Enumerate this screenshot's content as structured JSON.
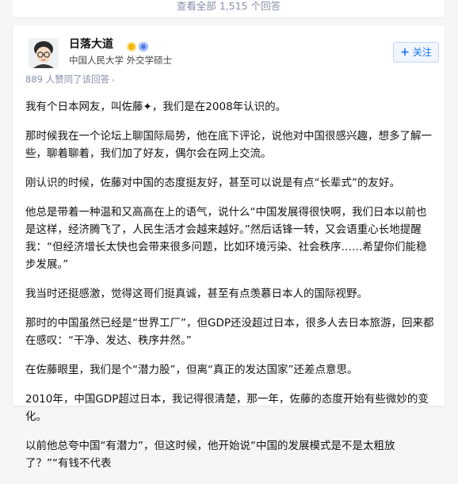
{
  "more_answers": {
    "label": "查看全部 1,515 个回答"
  },
  "author": {
    "name": "日落大道",
    "bio": "中国人民大学 外交学硕士",
    "badges": [
      "gold-badge-icon",
      "blue-badge-icon"
    ]
  },
  "follow": {
    "label": "关注"
  },
  "upvotes": {
    "label": "889 人赞同了该回答"
  },
  "paragraphs": [
    "我有个日本网友，叫佐藤✦，我们是在2008年认识的。",
    "那时候我在一个论坛上聊国际局势，他在底下评论，说他对中国很感兴趣，想多了解一些，聊着聊着，我们加了好友，偶尔会在网上交流。",
    "刚认识的时候，佐藤对中国的态度挺友好，甚至可以说是有点“长辈式”的友好。",
    "他总是带着一种温和又高高在上的语气，说什么“中国发展得很快啊，我们日本以前也是这样，经济腾飞了，人民生活才会越来越好。”然后话锋一转，又会语重心长地提醒我：“但经济增长太快也会带来很多问题，比如环境污染、社会秩序……希望你们能稳步发展。”",
    "我当时还挺感激，觉得这哥们挺真诚，甚至有点羡慕日本人的国际视野。",
    "那时的中国虽然已经是“世界工厂”，但GDP还没超过日本，很多人去日本旅游，回来都在感叹：“干净、发达、秩序井然。”",
    "在佐藤眼里，我们是个“潜力股”，但离“真正的发达国家”还差点意思。",
    "2010年，中国GDP超过日本，我记得很清楚，那一年，佐藤的态度开始有些微妙的变化。",
    "以前他总夸中国“有潜力”，但这时候，他开始说“中国的发展模式是不是太粗放了？”“有钱不代表"
  ]
}
